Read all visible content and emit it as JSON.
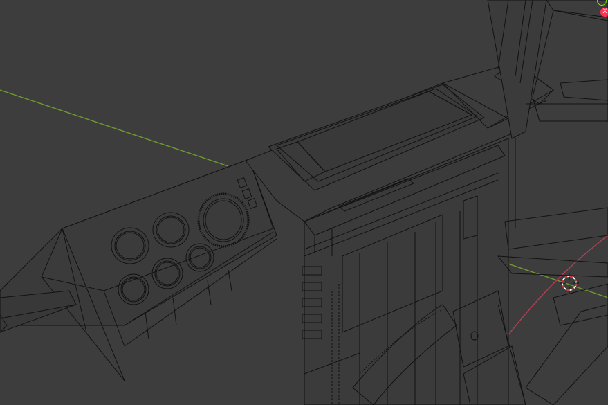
{
  "viewport": {
    "background": "#3d3d3d",
    "mode": "wireframe",
    "wire_color": "#0a0a0a",
    "edge_color": "#2b2b2b"
  },
  "axes": {
    "x_axis_color": "#b24055",
    "y_axis_color": "#6f9a2c"
  },
  "gizmo": {
    "x_label": "X",
    "x_color": "#ff3352",
    "y_color": "#8bdc00"
  },
  "cursor": {
    "icon": "3d-cursor-icon",
    "ring_color": "#ffffff",
    "dash_color": "#d32f2f"
  }
}
